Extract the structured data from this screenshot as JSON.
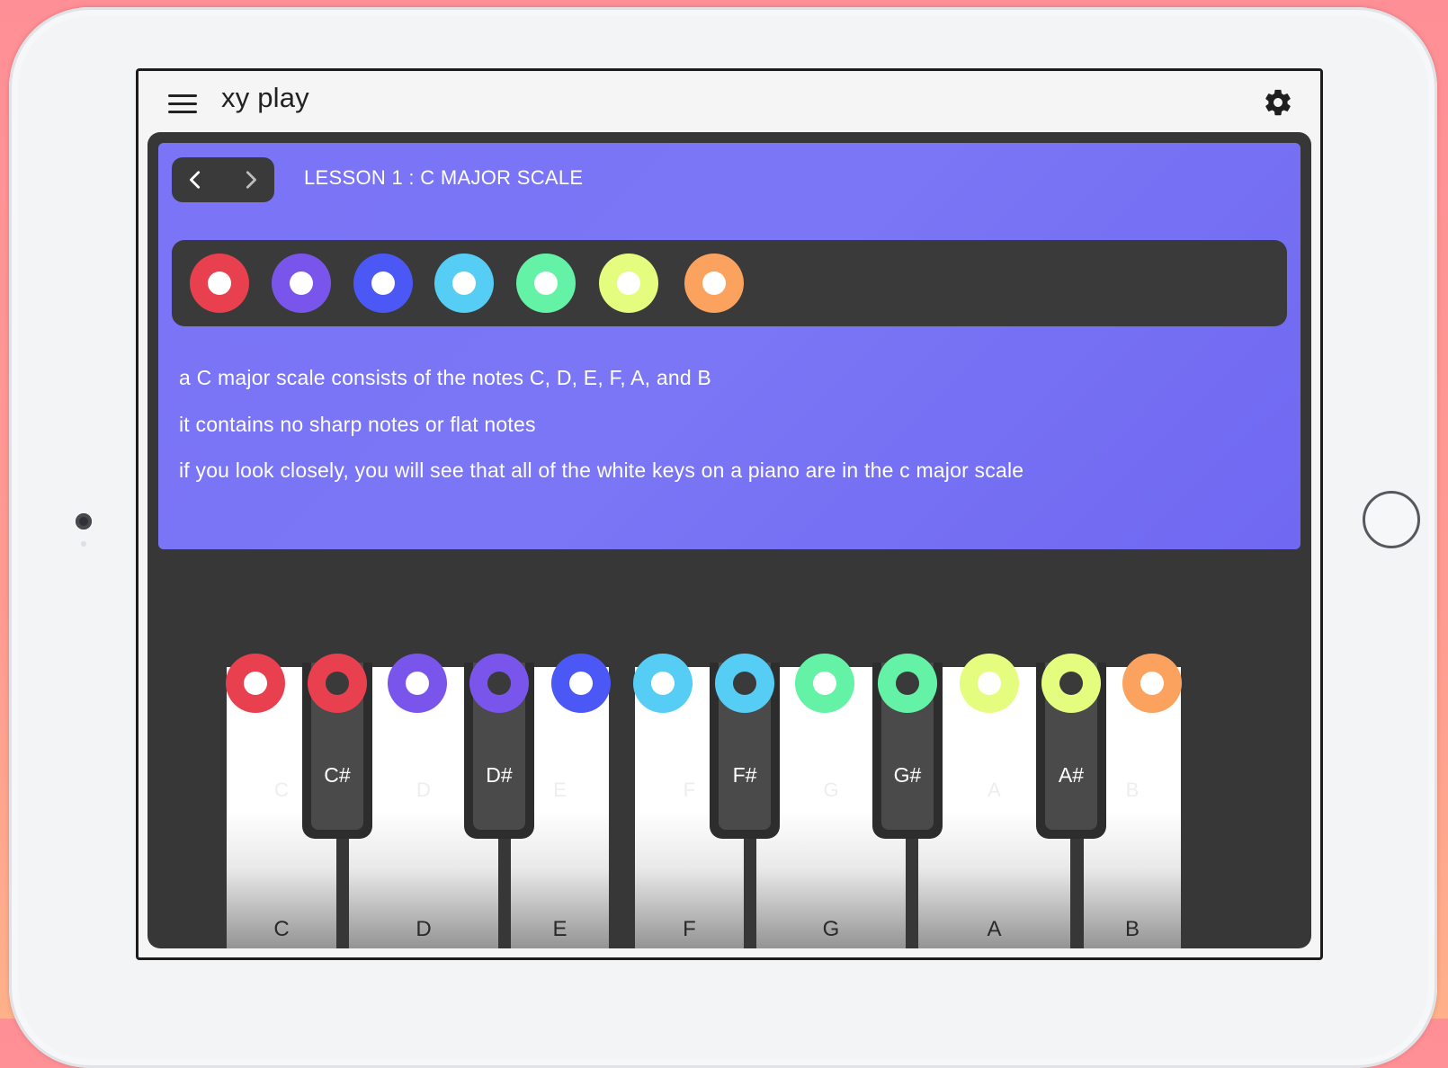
{
  "app": {
    "title": "xy play"
  },
  "lesson": {
    "title": "LESSON 1 : C MAJOR SCALE",
    "prev_label": "previous lesson",
    "next_label": "next lesson",
    "scale_dots": [
      {
        "note": "C",
        "color": "#e8404f"
      },
      {
        "note": "D",
        "color": "#7a55ec"
      },
      {
        "note": "E",
        "color": "#4b58f6"
      },
      {
        "note": "F",
        "color": "#56cdf5"
      },
      {
        "note": "G",
        "color": "#64f2a6"
      },
      {
        "note": "A",
        "color": "#e5fd7f"
      },
      {
        "note": "B",
        "color": "#fba35e"
      }
    ],
    "description": [
      "a C major scale consists of the notes C, D, E, F, A, and B",
      "it contains no sharp notes or flat notes",
      "if you look closely, you will see that all of the white keys on a piano are in the c major scale"
    ]
  },
  "keyboard": {
    "white_keys": [
      {
        "label": "C",
        "color": "#e8404f"
      },
      {
        "label": "D",
        "color": "#7a55ec"
      },
      {
        "label": "E",
        "color": "#4b58f6"
      },
      {
        "label": "F",
        "color": "#56cdf5"
      },
      {
        "label": "G",
        "color": "#64f2a6"
      },
      {
        "label": "A",
        "color": "#e5fd7f"
      },
      {
        "label": "B",
        "color": "#fba35e"
      }
    ],
    "black_keys": [
      {
        "label": "C#",
        "color": "#e8404f"
      },
      {
        "label": "D#",
        "color": "#7a55ec"
      },
      {
        "label": "F#",
        "color": "#56cdf5"
      },
      {
        "label": "G#",
        "color": "#64f2a6"
      },
      {
        "label": "A#",
        "color": "#e5fd7f"
      }
    ]
  }
}
